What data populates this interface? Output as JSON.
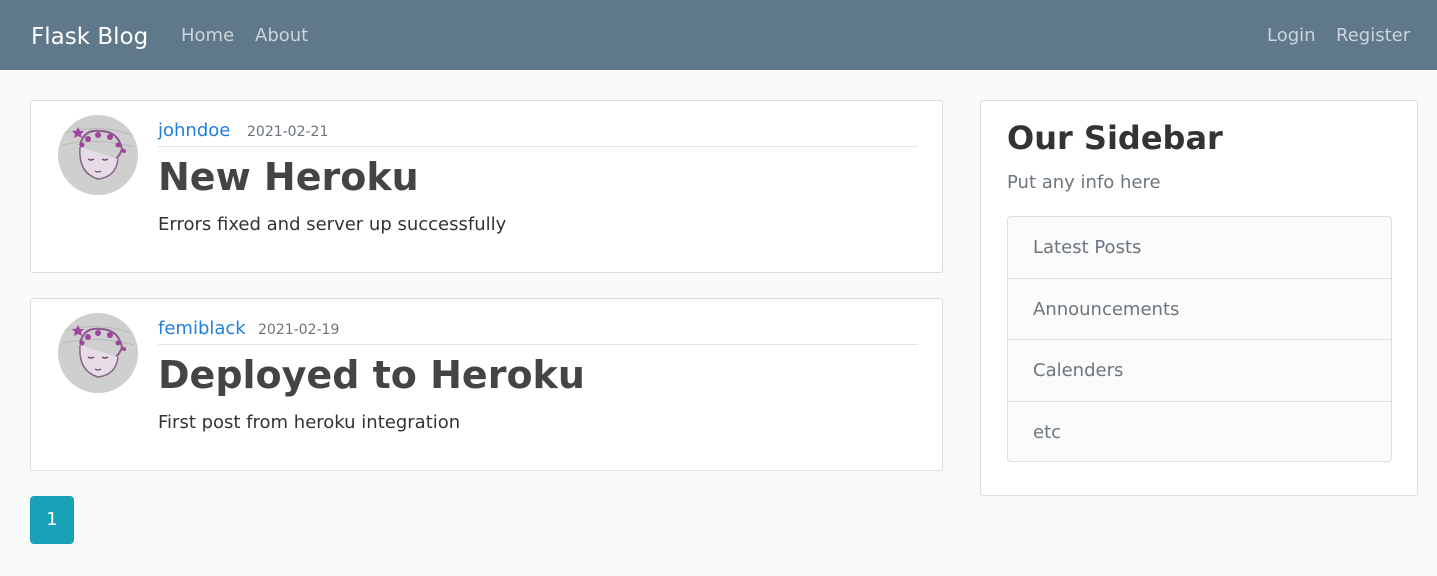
{
  "navbar": {
    "brand": "Flask Blog",
    "links_left": [
      "Home",
      "About"
    ],
    "links_right": [
      "Login",
      "Register"
    ],
    "background": "#5f788a"
  },
  "posts": [
    {
      "author": "johndoe",
      "date": "2021-02-21",
      "title": "New Heroku",
      "content": "Errors fixed and server up successfully",
      "avatar_icon": "avatar-cartoon-face-icon"
    },
    {
      "author": "femiblack",
      "date": "2021-02-19",
      "title": "Deployed to Heroku",
      "content": "First post from heroku integration",
      "avatar_icon": "avatar-cartoon-face-icon"
    }
  ],
  "pagination": {
    "current_page": "1",
    "active_color": "#17a2b8"
  },
  "sidebar": {
    "title": "Our Sidebar",
    "subtitle": "Put any info here",
    "items": [
      "Latest Posts",
      "Announcements",
      "Calenders",
      "etc"
    ]
  },
  "colors": {
    "link": "#1f7fdb",
    "muted": "#6c757d"
  }
}
